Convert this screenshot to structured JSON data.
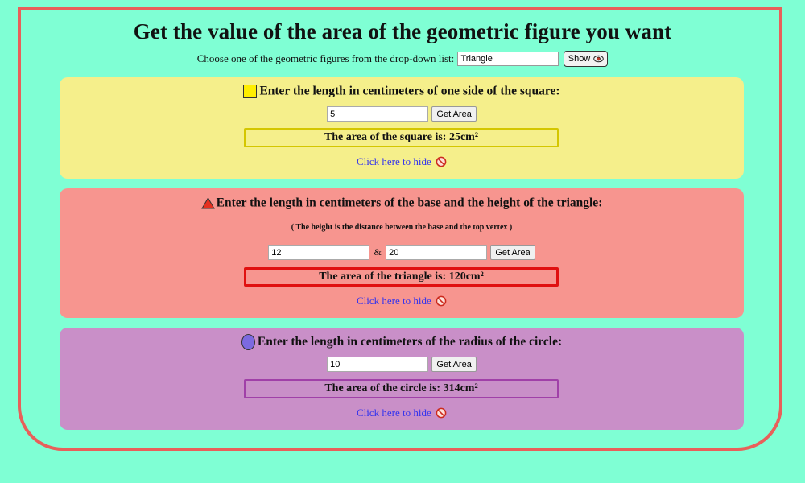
{
  "page": {
    "title": "Get the value of the area of the geometric figure you want",
    "chooser_label": "Choose one of the geometric figures from the drop-down list:",
    "chooser_value": "Triangle",
    "show_label": "Show"
  },
  "square": {
    "heading": "Enter the length in centimeters of one side of the square:",
    "side_value": "5",
    "button_label": "Get Area",
    "result": "The area of the square is: 25cm²",
    "hide_label": "Click here to hide"
  },
  "triangle": {
    "heading": "Enter the length in centimeters of the base and the height of the triangle:",
    "note": "( The height is the distance between the base and the top vertex )",
    "base_value": "12",
    "separator": "&",
    "height_value": "20",
    "button_label": "Get Area",
    "result": "The area of the triangle is: 120cm²",
    "hide_label": "Click here to hide"
  },
  "circle": {
    "heading": "Enter the length in centimeters of the radius of the circle:",
    "radius_value": "10",
    "button_label": "Get Area",
    "result": "The area of the circle is: 314cm²",
    "hide_label": "Click here to hide"
  },
  "icons": {
    "show": "eye-icon",
    "hide": "ban-icon",
    "square": "yellow-square-icon",
    "triangle": "red-triangle-icon",
    "circle": "purple-circle-icon"
  },
  "colors": {
    "background": "#7fffd4",
    "frame": "#e8605a",
    "square_panel": "#f5ef8b",
    "triangle_panel": "#f7958f",
    "circle_panel": "#c98fc8",
    "link": "#3333ee"
  }
}
